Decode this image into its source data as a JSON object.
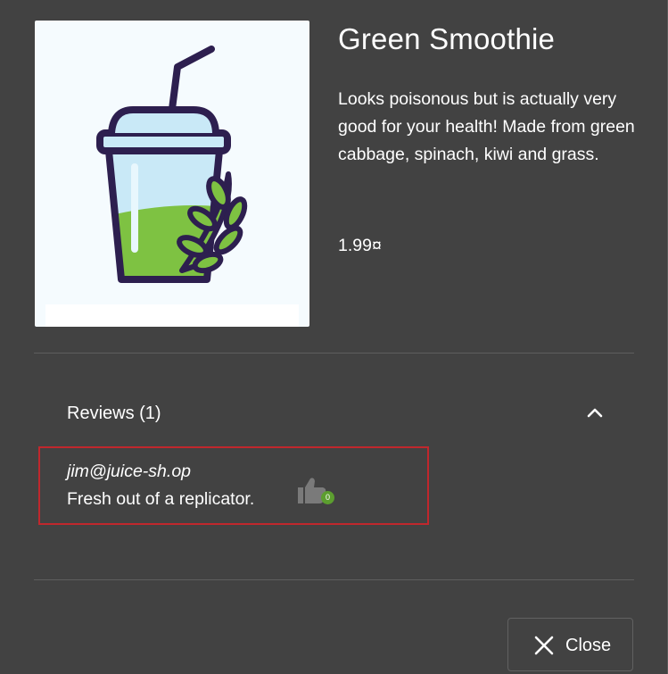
{
  "product": {
    "name": "Green Smoothie",
    "description": "Looks poisonous but is actually very good for your health! Made from green cabbage, spinach, kiwi and grass.",
    "price": "1.99¤",
    "image_icon": "smoothie-cup-with-leaves"
  },
  "reviews": {
    "title": "Reviews (1)",
    "expanded": true,
    "items": [
      {
        "author": "jim@juice-sh.op",
        "text": "Fresh out of a replicator.",
        "likes": "0"
      }
    ]
  },
  "actions": {
    "close_label": "Close",
    "close_icon": "close-icon"
  },
  "colors": {
    "dialog_background": "#424242",
    "review_highlight": "#c0272d",
    "like_badge": "#5c9e2f",
    "smoothie_green": "#7ec242",
    "outline_purple": "#2d1f4f"
  }
}
